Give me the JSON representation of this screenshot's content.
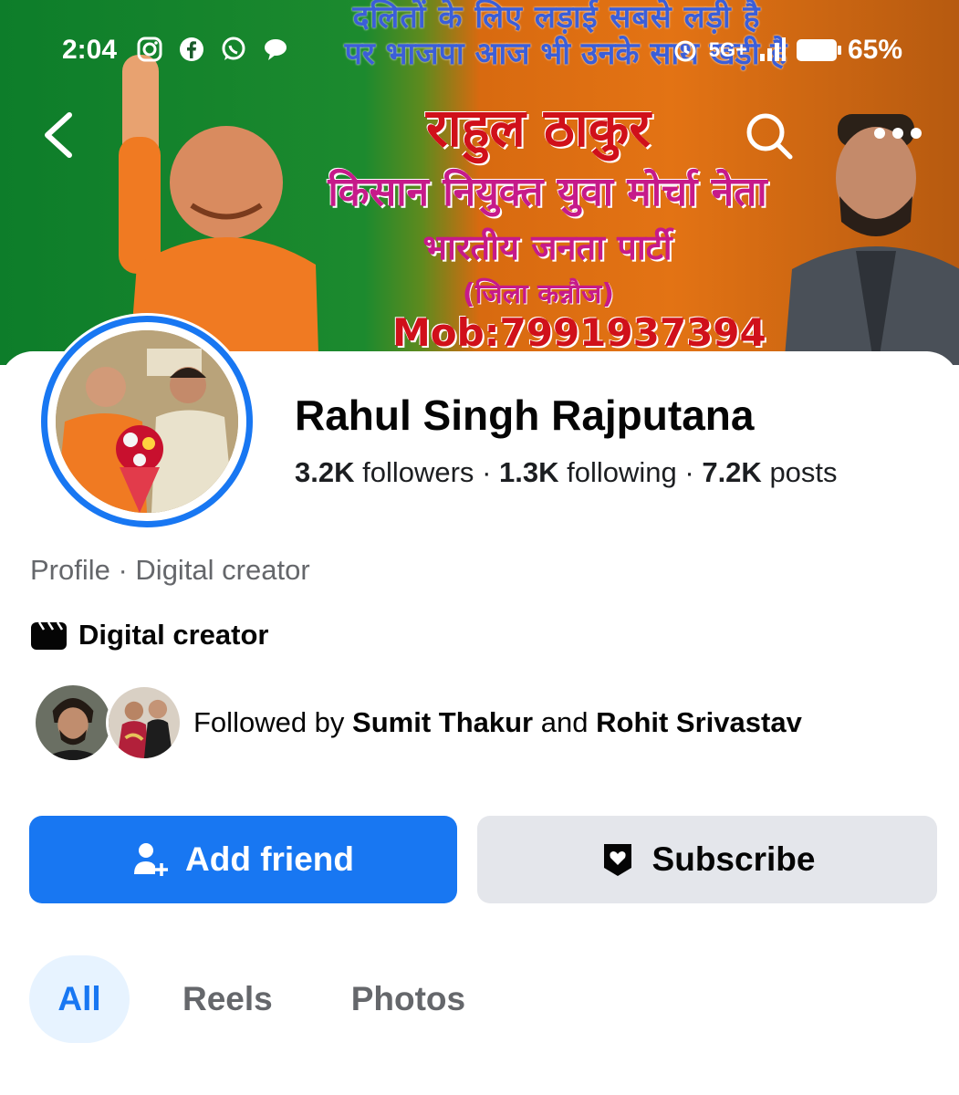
{
  "status_bar": {
    "time": "2:04",
    "network": "5G+",
    "battery": "65%"
  },
  "cover": {
    "slogan_line1": "दलितों के लिए लड़ाई सबसे लड़ी है",
    "slogan_line2": "पर भाजपा आज भी उनके साथ खड़ी है",
    "name": "राहुल ठाकुर",
    "role": "किसान नियुक्त युवा मोर्चा नेता",
    "party": "भारतीय जनता पार्टी",
    "district": "(जिला कन्नौज)",
    "mobile": "Mob:7991937394"
  },
  "profile": {
    "name": "Rahul Singh Rajputana",
    "followers_count": "3.2K",
    "followers_label": "followers",
    "following_count": "1.3K",
    "following_label": "following",
    "posts_count": "7.2K",
    "posts_label": "posts",
    "separator": "·",
    "type_line": "Profile · Digital creator",
    "category": "Digital creator"
  },
  "followed_by": {
    "prefix": "Followed by",
    "name1": "Sumit Thakur",
    "joiner": "and",
    "name2": "Rohit Srivastav"
  },
  "actions": {
    "add_friend": "Add friend",
    "subscribe": "Subscribe"
  },
  "tabs": [
    {
      "label": "All",
      "active": true
    },
    {
      "label": "Reels",
      "active": false
    },
    {
      "label": "Photos",
      "active": false
    }
  ],
  "colors": {
    "accent": "#1877f2",
    "secondary_button": "#e4e6eb",
    "muted_text": "#65676b",
    "active_tab_bg": "#e7f3ff"
  }
}
